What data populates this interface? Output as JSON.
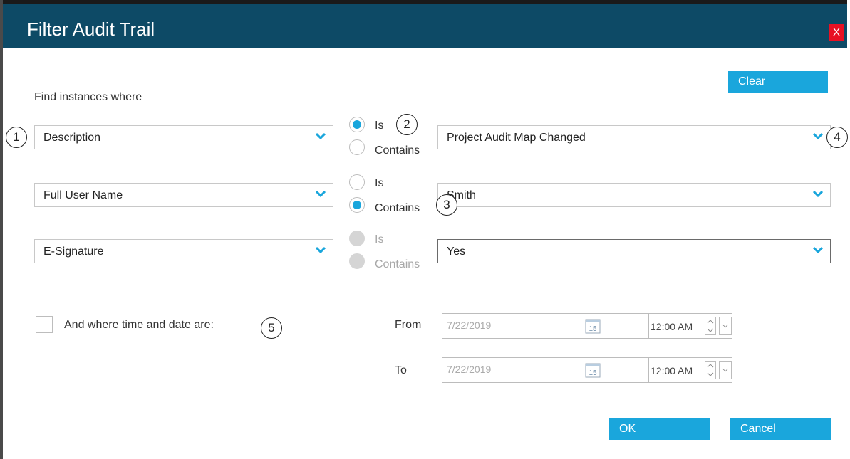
{
  "dialog": {
    "title": "Filter Audit Trail",
    "close_label": "X",
    "clear_label": "Clear",
    "find_label": "Find instances where",
    "ok_label": "OK",
    "cancel_label": "Cancel"
  },
  "rows": [
    {
      "field": "Description",
      "is_label": "Is",
      "contains_label": "Contains",
      "match": "Is",
      "value": "Project Audit Map Changed",
      "enabled": true
    },
    {
      "field": "Full User Name",
      "is_label": "Is",
      "contains_label": "Contains",
      "match": "Contains",
      "value": "Smith",
      "enabled": true
    },
    {
      "field": "E-Signature",
      "is_label": "Is",
      "contains_label": "Contains",
      "match": "Contains",
      "value": "Yes",
      "enabled": false
    }
  ],
  "datetime": {
    "checkbox_label": "And where time and date are:",
    "checked": false,
    "from_label": "From",
    "to_label": "To",
    "from_date": "7/22/2019",
    "from_time": "12:00 AM",
    "to_date": "7/22/2019",
    "to_time": "12:00 AM",
    "calendar_day": "15"
  },
  "callouts": [
    "1",
    "2",
    "3",
    "4",
    "5"
  ],
  "colors": {
    "titlebar": "#0d4a66",
    "accent": "#1aa6dc",
    "close": "#e81123"
  },
  "icons": {
    "chevron": "chevron-down-icon",
    "calendar": "calendar-icon",
    "spin": "spinner-icon"
  }
}
